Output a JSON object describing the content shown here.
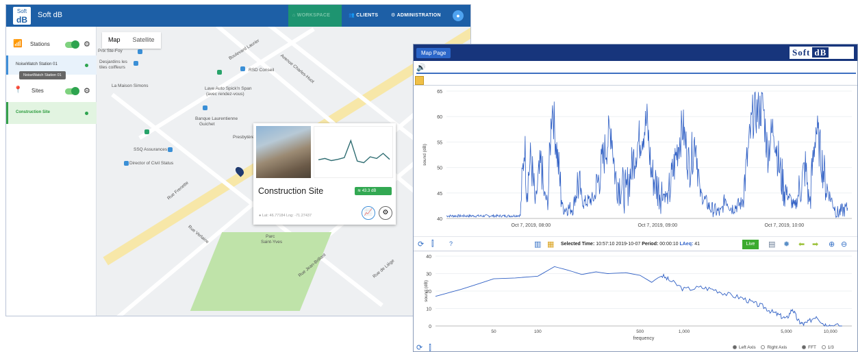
{
  "app": {
    "logo": {
      "top": "Soft",
      "bottom": "dB"
    },
    "title": "Soft dB",
    "nav": {
      "workspace": "WORKSPACE",
      "clients": "CLIENTS",
      "administration": "ADMINISTRATION"
    }
  },
  "sidebar": {
    "stations_label": "Stations",
    "station_item": "NoiseWatch Station 01",
    "tooltip": "NoiseWatch Station 01",
    "sites_label": "Sites",
    "site_item": "Construction Site"
  },
  "map": {
    "tabs": [
      "Map",
      "Satellite"
    ],
    "labels": [
      "Prix Ste-Foy",
      "Desjardins les",
      "tiles coiffeurs",
      "La Maison Simons",
      "RSD Conseil",
      "Lave Auto Spick'n Span",
      "(avec rendez-vous)",
      "Banque Laurentienne",
      "Guichet",
      "Presbytère",
      "SSQ Assurances",
      "Director of Civil Status",
      "Parc",
      "Saint-Yves",
      "Boulevard Laurier",
      "Avenue Charles-Huot",
      "Rue Frenette",
      "Rue Jean-Brillant",
      "Rue Verlaine",
      "Rue de Liège"
    ]
  },
  "popup": {
    "title": "Construction Site",
    "level": "43.3 dB",
    "coords": "Lat: 46.77184 Lng: -71.27437",
    "mini_chart": [
      0.35,
      0.38,
      0.33,
      0.36,
      0.4,
      0.8,
      0.32,
      0.28,
      0.42,
      0.38,
      0.5,
      0.36
    ]
  },
  "data_window": {
    "map_page": "Map Page",
    "logo_left": "Soft",
    "logo_right": "dB",
    "selected_time_label": "Selected Time:",
    "selected_time": "10:57:10 2019-10-07",
    "period_label": "Period:",
    "period": "00:00:10",
    "laeq_label": "LAeq:",
    "laeq": "41",
    "live": "Live",
    "left_axis": "Left Axis",
    "right_axis": "Right Axis",
    "fft": "FFT",
    "third": "1/3",
    "colors": {
      "accent": "#17357c",
      "series": "#2f5fc4",
      "live": "#3cab2e"
    }
  },
  "chart_data": [
    {
      "type": "line",
      "title": "",
      "ylabel": "sound (dB)",
      "xlabel": "",
      "ylim": [
        40,
        65
      ],
      "yticks": [
        40,
        45,
        50,
        55,
        60,
        65
      ],
      "xticks": [
        "Oct 7, 2019, 08:00",
        "Oct 7, 2019, 09:00",
        "Oct 7, 2019, 10:00"
      ],
      "x_minutes_since_0720": [
        0,
        30,
        35,
        37,
        38,
        40,
        42,
        45,
        46,
        48,
        50,
        55,
        60,
        62,
        65,
        70,
        75,
        78,
        80,
        85,
        90,
        95,
        97,
        100,
        105,
        110,
        112,
        115,
        118,
        120,
        125,
        130,
        132,
        135,
        140,
        145,
        150,
        152,
        155,
        158,
        160,
        165,
        170,
        172,
        175,
        180,
        185,
        190
      ],
      "series": [
        {
          "values": [
            40.5,
            40.5,
            40.6,
            55,
            46,
            52,
            43,
            51,
            45,
            43,
            63,
            42,
            42,
            47,
            43,
            44,
            53,
            58,
            48,
            45,
            54,
            59,
            49,
            46,
            44,
            55,
            58,
            50,
            56,
            45,
            42,
            41,
            44,
            42,
            43,
            60,
            62,
            53,
            58,
            49,
            46,
            42,
            50,
            43,
            58,
            46,
            41,
            42
          ]
        }
      ]
    },
    {
      "type": "line",
      "title": "",
      "ylabel": "sound (dB)",
      "xlabel": "frequency",
      "x_scale": "log",
      "ylim": [
        0,
        40
      ],
      "yticks": [
        0,
        10,
        20,
        30,
        40
      ],
      "xticks": [
        "50",
        "100",
        "500",
        "1,000",
        "5,000",
        "10,000"
      ],
      "series": [
        {
          "x": [
            20,
            30,
            50,
            70,
            100,
            130,
            160,
            200,
            250,
            300,
            400,
            500,
            600,
            700,
            800,
            1000,
            1300,
            1600,
            2000,
            2500,
            3000,
            3500,
            4000,
            4500,
            5000,
            5500,
            6000,
            6500,
            7000,
            8000,
            9000,
            10000,
            12000
          ],
          "values": [
            17,
            21,
            27,
            27.5,
            28.5,
            34,
            32,
            29.5,
            31,
            30,
            30.5,
            29,
            25,
            29,
            26,
            21,
            22,
            21,
            18,
            16,
            13,
            11,
            8,
            6,
            4,
            10,
            3,
            1,
            2,
            6,
            1,
            0.5,
            0
          ]
        }
      ]
    }
  ]
}
